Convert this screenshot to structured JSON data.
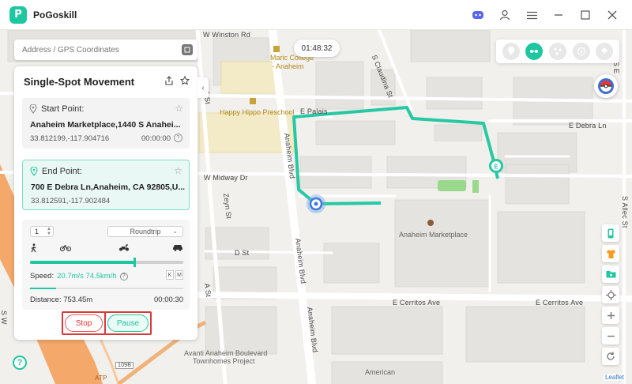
{
  "app": {
    "name": "PoGoskill",
    "logo_letter": "P"
  },
  "titlebar_icons": [
    "discord-icon",
    "user-icon",
    "menu-icon",
    "minimize-icon",
    "maximize-icon",
    "close-icon"
  ],
  "search": {
    "placeholder": "Address / GPS Coordinates"
  },
  "timer": "01:48:32",
  "panel": {
    "title": "Single-Spot Movement",
    "start": {
      "label": "Start Point:",
      "address": "Anaheim Marketplace,1440 S Anahei...",
      "coords": "33.812199,-117.904716",
      "time": "00:00:00"
    },
    "end": {
      "label": "End Point:",
      "address": "700 E Debra Ln,Anaheim, CA  92805,U...",
      "coords": "33.812591,-117.902484"
    },
    "count": "1",
    "mode": "Roundtrip",
    "speed_label": "Speed:",
    "speed_value": "20.7m/s 74.5km/h",
    "speed_slider_fraction": 0.68,
    "unit_k": "K",
    "unit_m": "M",
    "progress_fraction": 0.17,
    "distance": "Distance: 753.45m",
    "duration": "00:00:30",
    "stop": "Stop",
    "pause": "Pause"
  },
  "map": {
    "streets": {
      "winston": "W Winston Rd",
      "claudina": "S Claudina St",
      "epalais": "E Palais",
      "debra": "E Debra Ln",
      "midway": "W Midway Dr",
      "anaheim1": "Anaheim Blvd",
      "anaheim2": "Anaheim Blvd",
      "anaheim3": "Anaheim Blvd",
      "zeyn": "Zeyn St",
      "dst": "D St",
      "cerritos1": "E Cerritos Ave",
      "cerritos2": "E Cerritos Ave",
      "allec": "S Allec St",
      "ast": "A St",
      "cst": "C St",
      "s_e": "S E",
      "s_w": "S W",
      "hwy": "109B",
      "hwy_exit": "ATP"
    },
    "pois": {
      "maric": "Maric College",
      "maric2": "- Anaheim",
      "hippo": "Happy Hippo Preschool",
      "market": "Anaheim Marketplace",
      "avanti1": "Avanti Anaheim Boulevard",
      "avanti2": "Townhomes Project",
      "american": "American"
    },
    "end_marker": "E",
    "attribution": "Leaflet"
  },
  "colors": {
    "accent": "#1fc7a0",
    "stop": "#e33333",
    "highlight": "#d83a3a",
    "route": "#27c8a3"
  }
}
